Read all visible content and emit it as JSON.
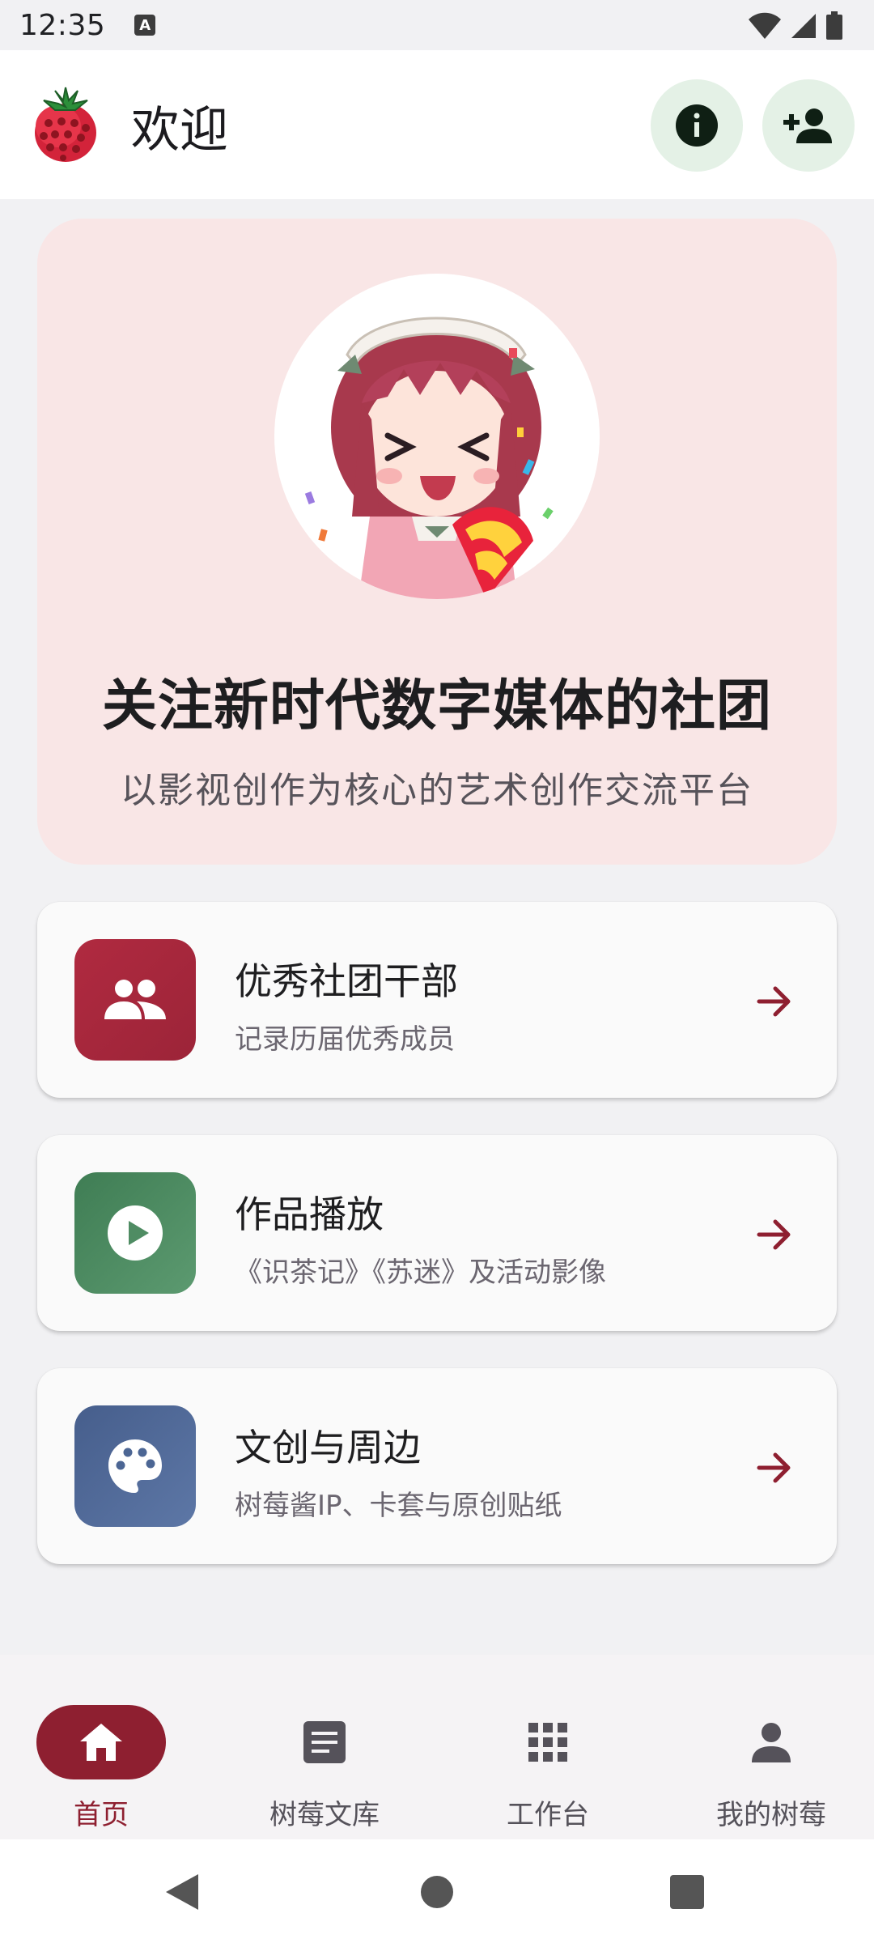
{
  "status_bar": {
    "time": "12:35",
    "notification_icon": "A",
    "icons": [
      "wifi-icon",
      "signal-icon",
      "battery-icon"
    ]
  },
  "app_bar": {
    "title": "欢迎",
    "logo": "strawberry-logo",
    "actions": [
      "info-icon",
      "person-add-icon"
    ]
  },
  "hero": {
    "title": "关注新时代数字媒体的社团",
    "subtitle": "以影视创作为核心的艺术创作交流平台"
  },
  "cards": [
    {
      "title": "优秀社团干部",
      "desc": "记录历届优秀成员",
      "icon": "group-icon",
      "color": "#a82a3e"
    },
    {
      "title": "作品播放",
      "desc": "《识茶记》《苏迷》及活动影像",
      "icon": "play-circle-icon",
      "color": "#4f8c63"
    },
    {
      "title": "文创与周边",
      "desc": "树莓酱IP、卡套与原创贴纸",
      "icon": "palette-icon",
      "color": "#4c6694"
    }
  ],
  "bottom_nav": {
    "items": [
      {
        "label": "首页",
        "icon": "home-icon",
        "active": true
      },
      {
        "label": "树莓文库",
        "icon": "article-icon",
        "active": false
      },
      {
        "label": "工作台",
        "icon": "apps-grid-icon",
        "active": false
      },
      {
        "label": "我的树莓",
        "icon": "person-icon",
        "active": false
      }
    ]
  },
  "colors": {
    "accent": "#8e1f30",
    "hero_bg": "#f9e6e6",
    "action_btn_bg": "#e4f1e6"
  }
}
